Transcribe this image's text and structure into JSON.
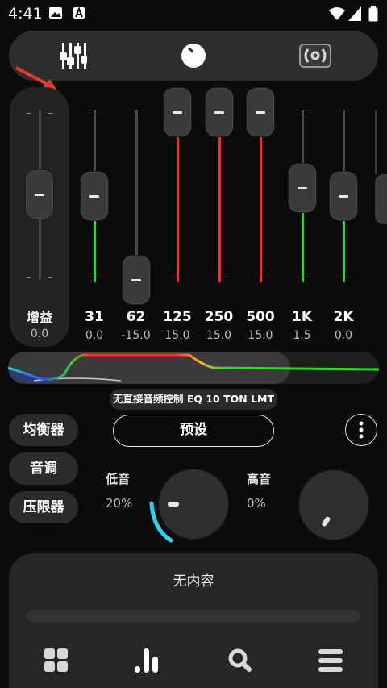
{
  "status_bar": {
    "time": "4:41"
  },
  "equalizer": {
    "gain": {
      "label": "增益",
      "value": "0.0",
      "level": 0
    },
    "bands": [
      {
        "freq": "31",
        "value": "0.0",
        "gain_db": 0
      },
      {
        "freq": "62",
        "value": "-15.0",
        "gain_db": -15
      },
      {
        "freq": "125",
        "value": "15.0",
        "gain_db": 15
      },
      {
        "freq": "250",
        "value": "15.0",
        "gain_db": 15
      },
      {
        "freq": "500",
        "value": "15.0",
        "gain_db": 15
      },
      {
        "freq": "1K",
        "value": "1.5",
        "gain_db": 1.5
      },
      {
        "freq": "2K",
        "value": "0.0",
        "gain_db": 0
      }
    ],
    "preset_status": "无直接音频控制 EQ 10 TON LMT"
  },
  "side_tabs": {
    "equalizer": "均衡器",
    "tone": "音调",
    "limiter": "压限器"
  },
  "presets_label": "预设",
  "tone": {
    "bass": {
      "label": "低音",
      "value": "20%"
    },
    "treble": {
      "label": "高音",
      "value": "0%"
    }
  },
  "player": {
    "empty_label": "无内容"
  },
  "colors": {
    "accent_red": "#ff2b2b",
    "accent_green": "#2bd82b",
    "cyan": "#2bd3f0"
  }
}
